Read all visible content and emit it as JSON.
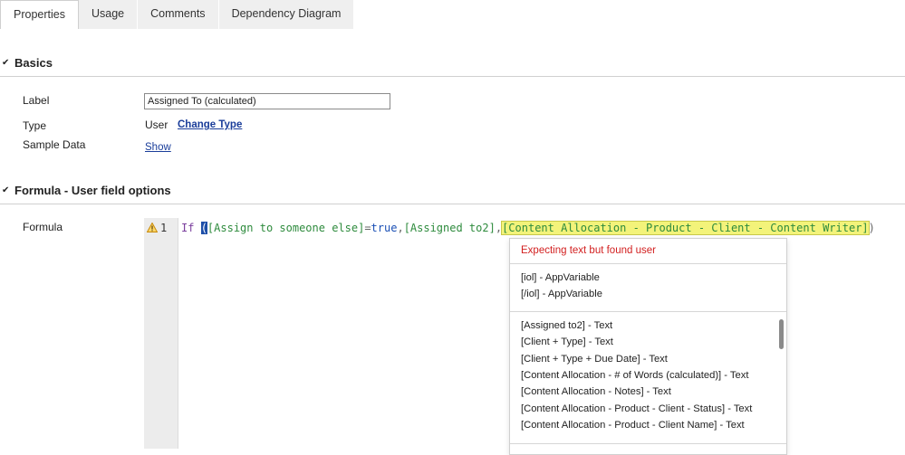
{
  "tabs": [
    {
      "label": "Properties",
      "active": true
    },
    {
      "label": "Usage",
      "active": false
    },
    {
      "label": "Comments",
      "active": false
    },
    {
      "label": "Dependency Diagram",
      "active": false
    }
  ],
  "sections": {
    "basics": {
      "title": "Basics"
    },
    "formula_options": {
      "title": "Formula - User field options"
    }
  },
  "basics": {
    "label_label": "Label",
    "label_value": "Assigned To (calculated)",
    "type_label": "Type",
    "type_value": "User",
    "change_type_link": "Change Type",
    "sample_label": "Sample Data",
    "show_link": "Show"
  },
  "formula": {
    "label": "Formula",
    "line_number": "1",
    "tokens": {
      "kw_if": "If",
      "open_paren": "(",
      "field1": "[Assign to someone else]",
      "equals": "=",
      "true_kw": "true",
      "comma1": ",",
      "field2": "[Assigned to2]",
      "comma2": ",",
      "field3": "[Content Allocation - Product - Client - Content Writer]",
      "close_paren": ")"
    }
  },
  "autocomplete": {
    "error": "Expecting text but found user",
    "group1": [
      "[iol] - AppVariable",
      "[/iol] - AppVariable"
    ],
    "group2": [
      "[Assigned to2] - Text",
      "[Client + Type] - Text",
      "[Client + Type + Due Date] - Text",
      "[Content Allocation - # of Words (calculated)] - Text",
      "[Content Allocation - Notes] - Text",
      "[Content Allocation - Product - Client - Status] - Text",
      "[Content Allocation - Product - Client Name] - Text"
    ]
  },
  "colors": {
    "accent_link": "#1a3d9a",
    "error": "#d21f1f",
    "keyword": "#7a3e9d",
    "field": "#2e8b3d",
    "highlight": "#f3f37a",
    "warning": "#e8a317"
  },
  "icons": {
    "section_toggle": "chevron-down-icon",
    "gutter_marker": "warning-icon"
  }
}
